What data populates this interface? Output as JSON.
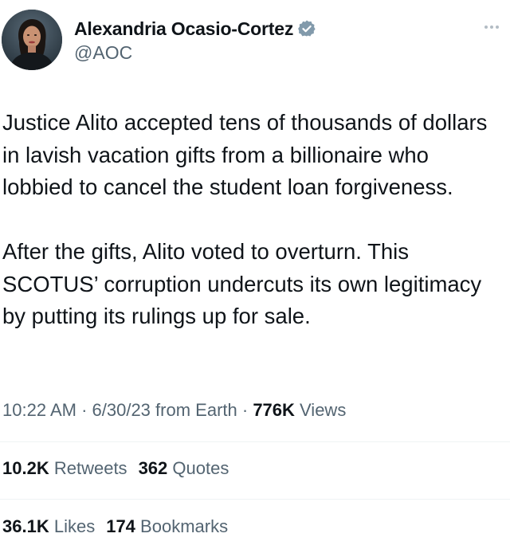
{
  "author": {
    "display_name": "Alexandria Ocasio-Cortez",
    "handle": "@AOC",
    "verified_icon": "verified-badge-icon",
    "avatar_icon": "profile-photo"
  },
  "more_icon": "more-options-icon",
  "tweet": {
    "paragraphs": [
      "Justice Alito accepted tens of thousands of dollars in lavish vacation gifts from a billionaire who lobbied to cancel the student loan forgiveness.",
      "After the gifts, Alito voted to overturn. This SCOTUS’ corruption undercuts its own legitimacy by putting its rulings up for sale."
    ]
  },
  "meta": {
    "time": "10:22 AM",
    "separator": " · ",
    "date": "6/30/23",
    "source": "from Earth",
    "views_count": "776K",
    "views_label": "Views"
  },
  "engagement": {
    "retweets_count": "10.2K",
    "retweets_label": "Retweets",
    "quotes_count": "362",
    "quotes_label": "Quotes",
    "likes_count": "36.1K",
    "likes_label": "Likes",
    "bookmarks_count": "174",
    "bookmarks_label": "Bookmarks"
  },
  "colors": {
    "text_primary": "#0f1419",
    "text_secondary": "#536471",
    "verified_badge": "#829aab",
    "divider": "#eff3f4"
  }
}
